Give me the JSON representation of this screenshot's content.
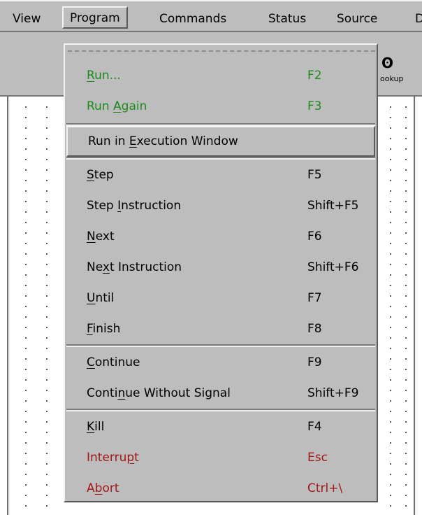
{
  "menubar": {
    "items": [
      {
        "label": "View"
      },
      {
        "label": "Program"
      },
      {
        "label": "Commands"
      },
      {
        "label": "Status"
      },
      {
        "label": "Source"
      },
      {
        "label": "D"
      }
    ]
  },
  "toolbar": {
    "lookup_label": "ookup",
    "lookup_icon": "lookup-icon"
  },
  "program_menu": {
    "items": [
      {
        "label": "Run...",
        "shortcut": "F2"
      },
      {
        "label": "Run Again",
        "shortcut": "F3"
      },
      {
        "label": "Run in Execution Window",
        "shortcut": ""
      },
      {
        "label": "Step",
        "shortcut": "F5"
      },
      {
        "label": "Step Instruction",
        "shortcut": "Shift+F5"
      },
      {
        "label": "Next",
        "shortcut": "F6"
      },
      {
        "label": "Next Instruction",
        "shortcut": "Shift+F6"
      },
      {
        "label": "Until",
        "shortcut": "F7"
      },
      {
        "label": "Finish",
        "shortcut": "F8"
      },
      {
        "label": "Continue",
        "shortcut": "F9"
      },
      {
        "label": "Continue Without Signal",
        "shortcut": "Shift+F9"
      },
      {
        "label": "Kill",
        "shortcut": "F4"
      },
      {
        "label": "Interrupt",
        "shortcut": "Esc"
      },
      {
        "label": "Abort",
        "shortcut": "Ctrl+\\"
      }
    ]
  },
  "colors": {
    "menu_bg": "#bdbdbd",
    "run_green": "#1e8a1e",
    "interrupt_red": "#a01818"
  }
}
